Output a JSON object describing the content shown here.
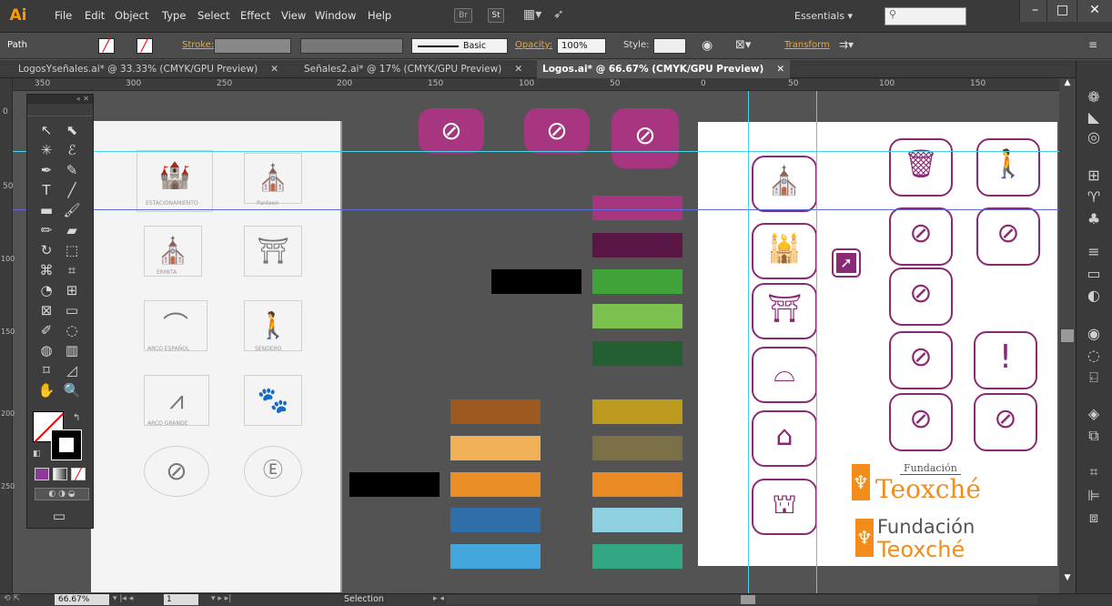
{
  "app": {
    "logo": "Ai",
    "menus": [
      "File",
      "Edit",
      "Object",
      "Type",
      "Select",
      "Effect",
      "View",
      "Window",
      "Help"
    ],
    "bridge_btn": "Br",
    "stock_btn": "St",
    "workspace": "Essentials"
  },
  "control_bar": {
    "selection_label": "Path",
    "stroke_label": "Stroke:",
    "brush_label": "Basic",
    "opacity_label": "Opacity:",
    "opacity_value": "100%",
    "style_label": "Style:",
    "transform_label": "Transform"
  },
  "tabs": [
    {
      "label": "LogosYseñales.ai* @ 33.33% (CMYK/GPU Preview)"
    },
    {
      "label": "Señales2.ai* @ 17% (CMYK/GPU Preview)"
    },
    {
      "label": "Logos.ai* @ 66.67% (CMYK/GPU Preview)"
    }
  ],
  "ruler": {
    "h_marks": [
      "350",
      "300",
      "250",
      "200",
      "150",
      "100",
      "50",
      "0",
      "50",
      "100",
      "150"
    ],
    "v_marks": [
      "0",
      "50",
      "100",
      "150",
      "200",
      "250"
    ]
  },
  "paper": {
    "captions": [
      "ESTACIONAMIENTO",
      "Panteon",
      "ERMITA",
      "ARCO ESPAÑOL",
      "SENDERO",
      "ARCO GRANDE"
    ]
  },
  "artboard": {
    "brand_word_1": "Fundación",
    "brand_word_2": "Teoxché",
    "brand_word_3": "Fundación",
    "brand_word_4": "Teoxché"
  },
  "colors": {
    "accent": "#8b2a74",
    "brand_orange": "#f28c1b",
    "guide": "#47d3e8",
    "swatches_right": [
      "#a8357f",
      "#5a1746",
      "#3fa33a",
      "#7cc150",
      "#235f31",
      "#bb9a1e",
      "#7b7045",
      "#ea8a24",
      "#8ecfe0",
      "#33a683"
    ],
    "swatches_left": [
      "#9c5a21",
      "#efb057",
      "#ea8e26",
      "#2f6ea8",
      "#43a6dd"
    ]
  },
  "status": {
    "zoom": "66.67%",
    "page": "1",
    "tool": "Selection"
  }
}
